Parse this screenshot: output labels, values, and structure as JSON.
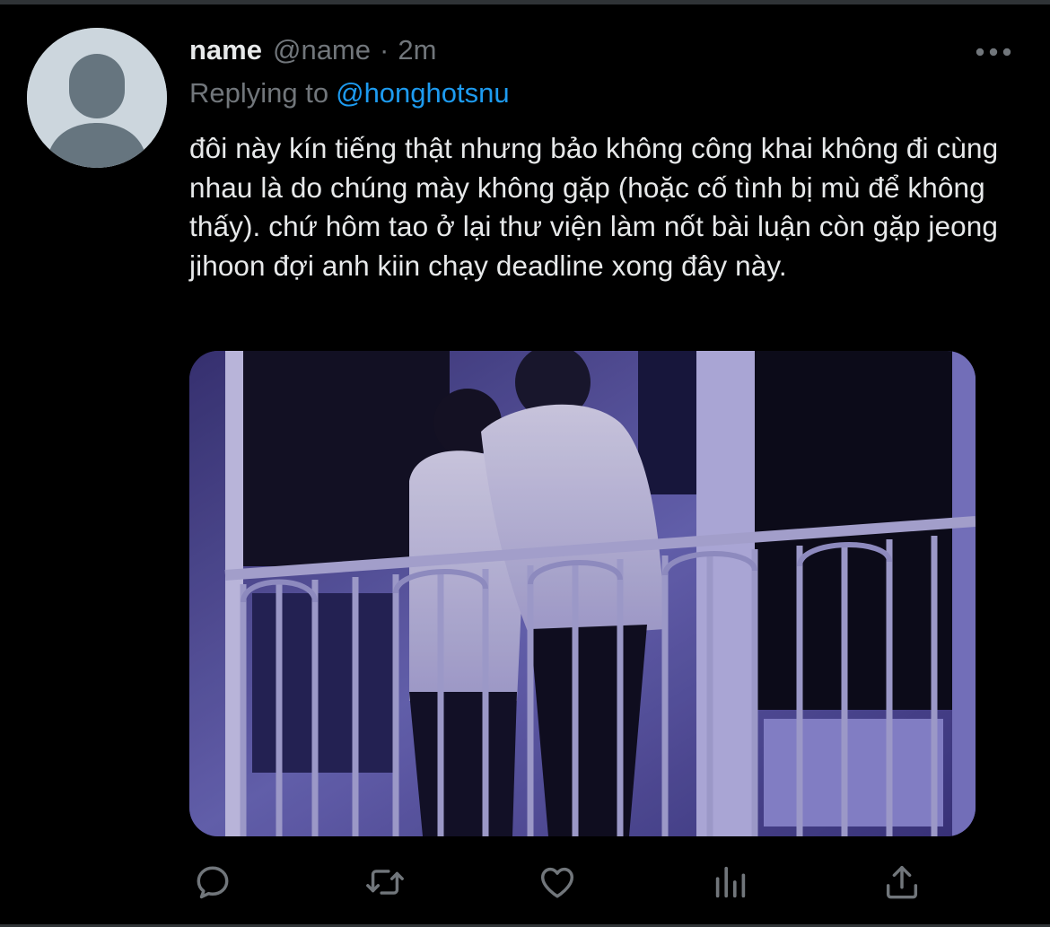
{
  "tweet": {
    "author": {
      "display_name": "name",
      "handle": "@name",
      "separator": "·",
      "time": "2m"
    },
    "replying_to": {
      "prefix": "Replying to",
      "handle": "@honghotsnu"
    },
    "text": "đôi này kín tiếng thật nhưng bảo không công khai không đi cùng nhau là do chúng mày không gặp (hoặc cố tình bị mù để không thấy). chứ hôm tao ở lại thư viện làm nốt bài luận còn gặp jeong jihoon đợi anh kiin chạy deadline xong đây này."
  },
  "actions": [
    {
      "name": "reply",
      "icon": "reply-icon"
    },
    {
      "name": "retweet",
      "icon": "retweet-icon"
    },
    {
      "name": "like",
      "icon": "heart-icon"
    },
    {
      "name": "analytics",
      "icon": "analytics-icon"
    },
    {
      "name": "share",
      "icon": "share-icon"
    }
  ],
  "colors": {
    "background": "#000000",
    "text": "#e7e9ea",
    "muted": "#71767b",
    "link": "#1d9bf0",
    "avatar_bg": "#ccd6dd",
    "avatar_fg": "#66757f"
  }
}
